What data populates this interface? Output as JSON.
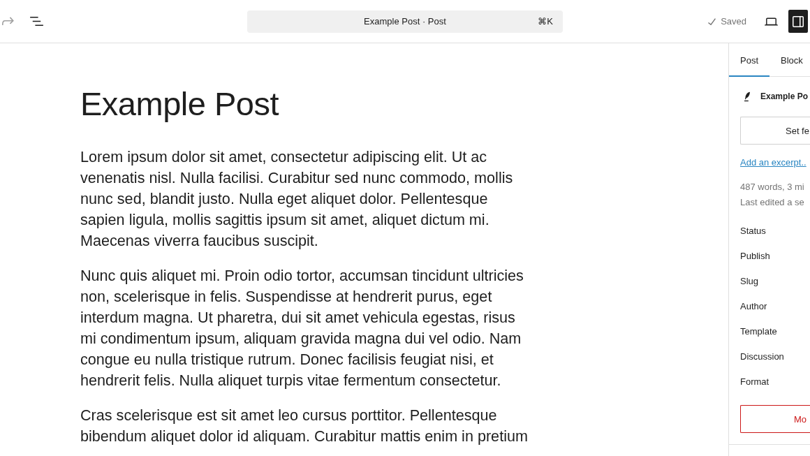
{
  "header": {
    "redo_button": {
      "disabled": true
    },
    "command_bar": {
      "title": "Example Post · Post",
      "shortcut": "⌘K"
    },
    "save_status": "Saved",
    "settings_toggle": {
      "pressed": true
    }
  },
  "editor": {
    "title": "Example Post",
    "paragraphs": [
      "Lorem ipsum dolor sit amet, consectetur adipiscing elit. Ut ac venenatis nisl. Nulla facilisi. Curabitur sed nunc commodo, mollis nunc sed, blandit justo. Nulla eget aliquet dolor. Pellentesque sapien ligula, mollis sagittis ipsum sit amet, aliquet dictum mi. Maecenas viverra faucibus suscipit.",
      "Nunc quis aliquet mi. Proin odio tortor, accumsan tincidunt ultricies non, scelerisque in felis. Suspendisse at hendrerit purus, eget interdum magna. Ut pharetra, dui sit amet vehicula egestas, risus mi condimentum ipsum, aliquam gravida magna dui vel odio. Nam congue eu nulla tristique rutrum. Donec facilisis feugiat nisi, et hendrerit felis. Nulla aliquet turpis vitae fermentum consectetur.",
      "Cras scelerisque est sit amet leo cursus porttitor. Pellentesque bibendum aliquet dolor id aliquam. Curabitur mattis enim in pretium"
    ]
  },
  "sidebar": {
    "tabs": [
      {
        "label": "Post",
        "selected": true
      },
      {
        "label": "Block",
        "selected": false
      }
    ],
    "post_title": "Example Po",
    "featured_image_button": "Set fe",
    "excerpt_link": "Add an excerpt..",
    "stats": [
      "487 words, 3 mi",
      "Last edited a se"
    ],
    "fields": [
      "Status",
      "Publish",
      "Slug",
      "Author",
      "Template",
      "Discussion",
      "Format"
    ],
    "trash_button": "Mo"
  }
}
